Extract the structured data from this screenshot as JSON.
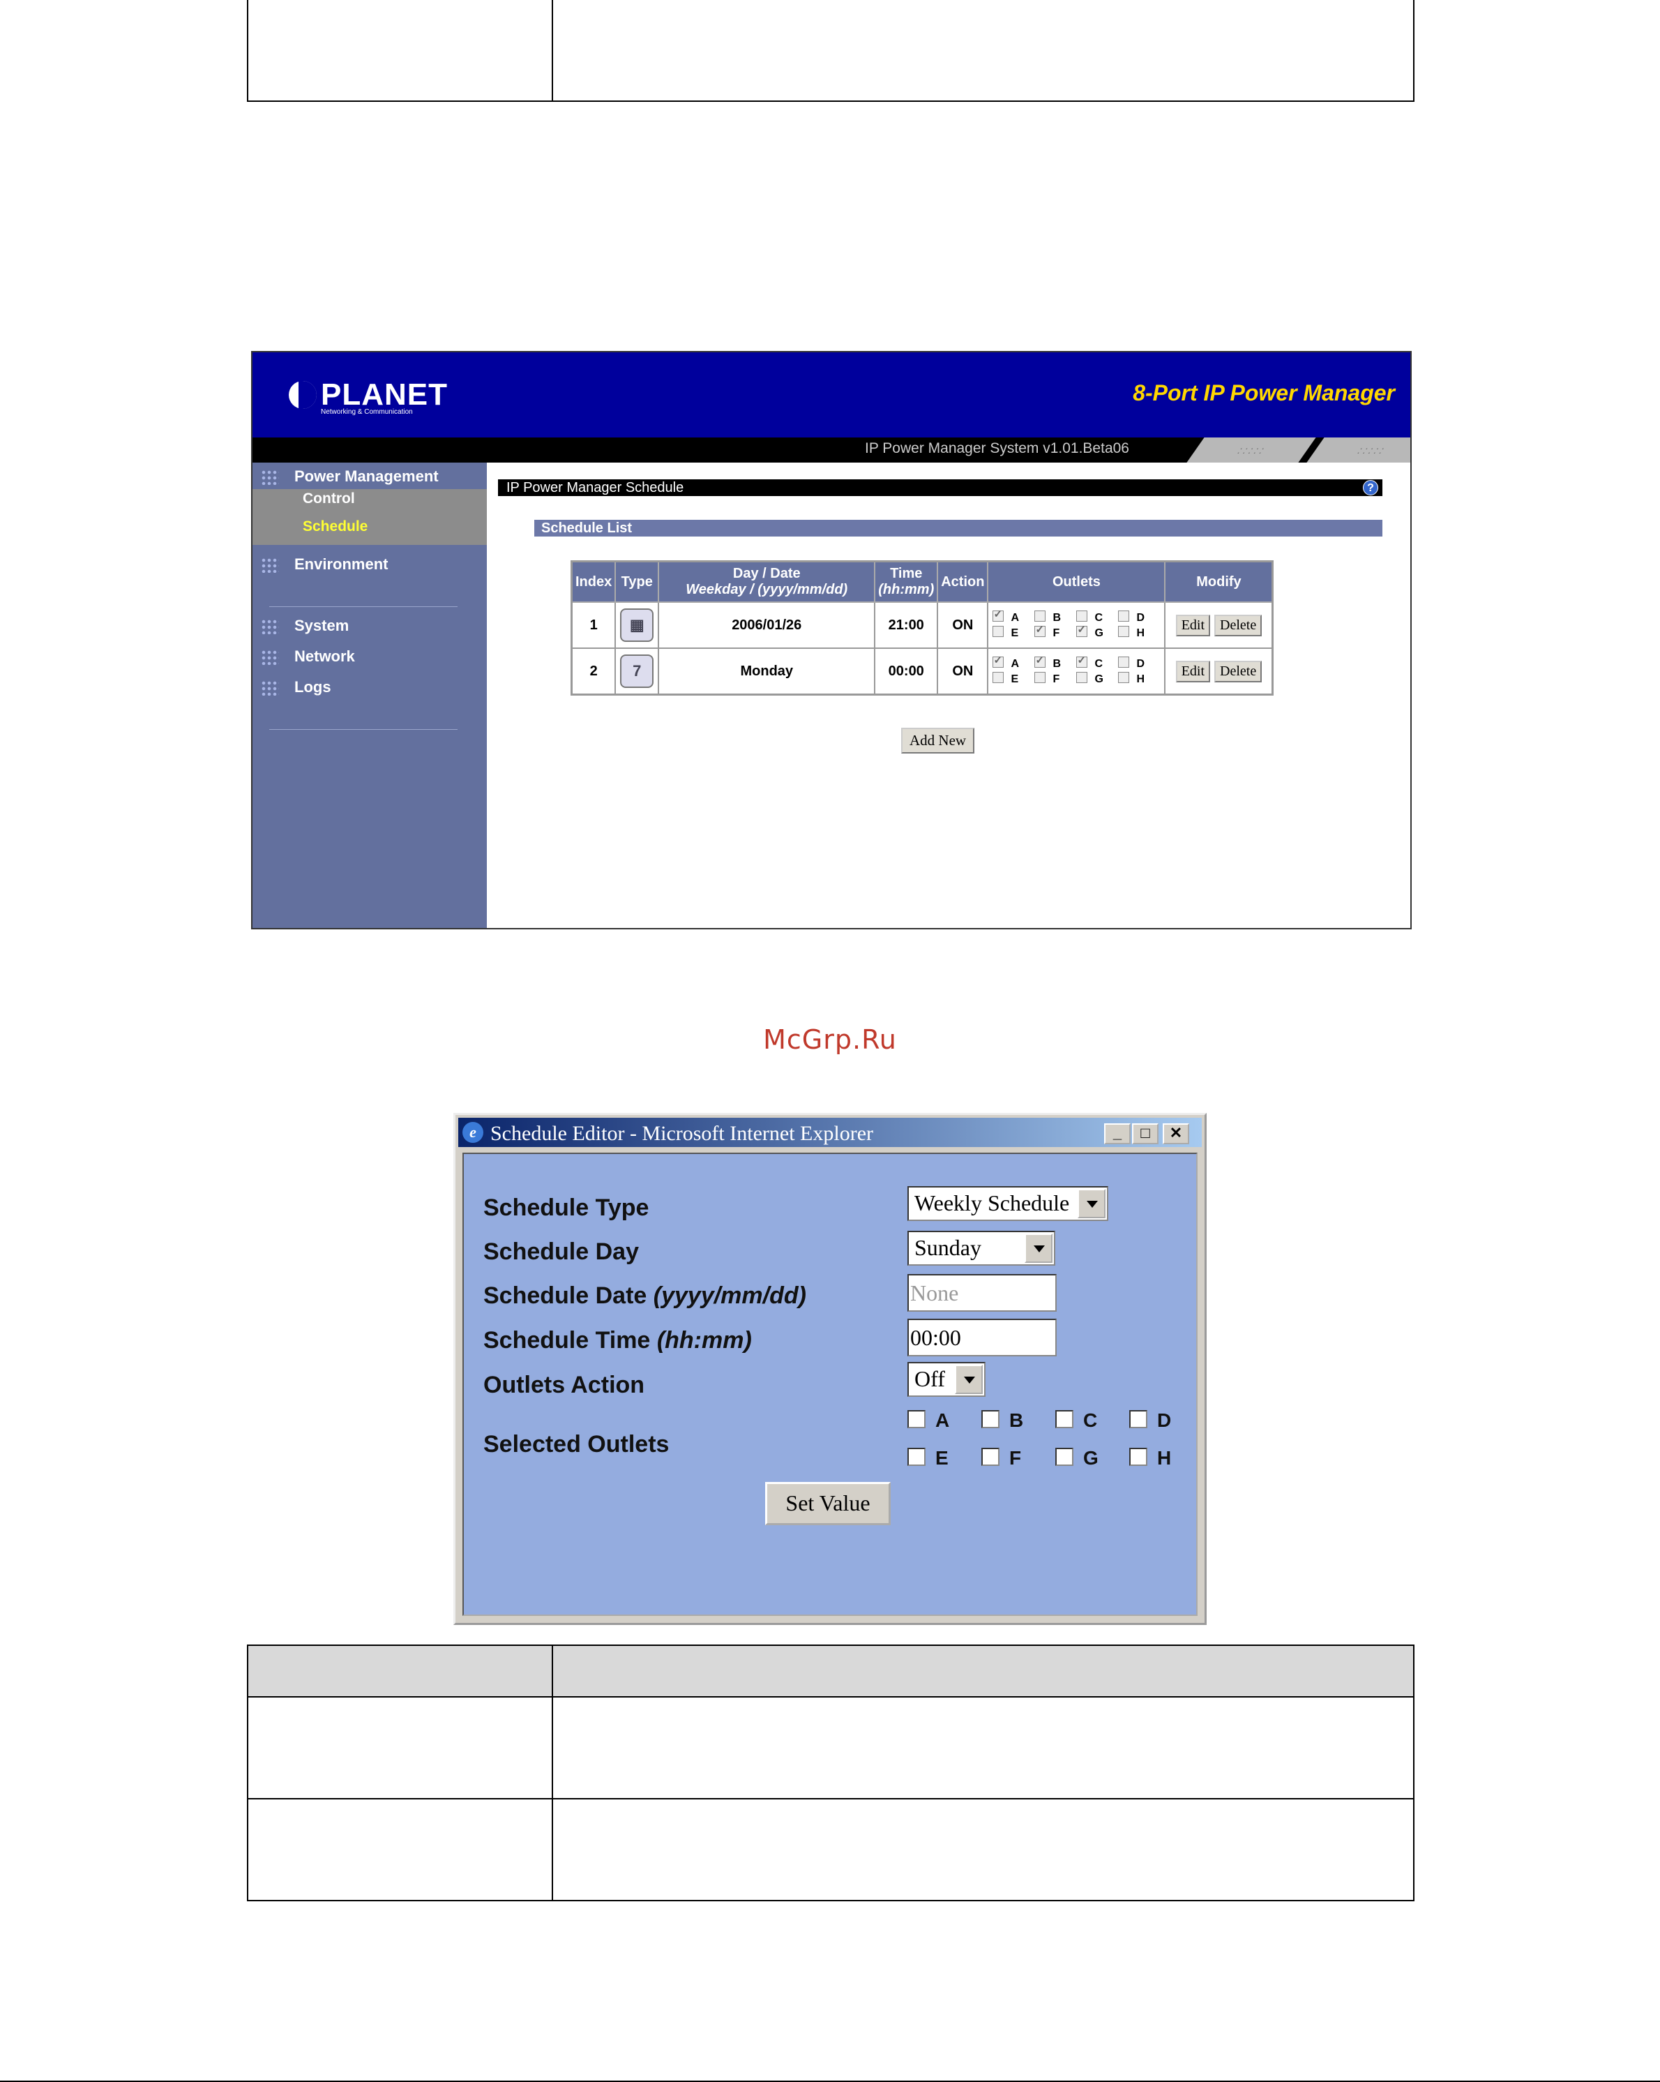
{
  "screenshot1": {
    "logo": {
      "name": "PLANET",
      "sub": "Networking & Communication"
    },
    "product_title": "8-Port IP Power Manager",
    "version": "IP Power Manager System v1.01.Beta06",
    "sidebar": {
      "items": [
        {
          "label": "Power Management"
        },
        {
          "label": "Environment"
        },
        {
          "label": "System"
        },
        {
          "label": "Network"
        },
        {
          "label": "Logs"
        }
      ],
      "subitems": [
        {
          "label": "Control"
        },
        {
          "label": "Schedule"
        }
      ]
    },
    "page_title": "IP Power Manager Schedule",
    "help_icon": "?",
    "section_title": "Schedule List",
    "table": {
      "headers": {
        "index": "Index",
        "type": "Type",
        "daydate": "Day / Date",
        "daydate_sub": "Weekday / (yyyy/mm/dd)",
        "time": "Time",
        "time_sub": "(hh:mm)",
        "action": "Action",
        "outlets": "Outlets",
        "modify": "Modify"
      },
      "rows": [
        {
          "index": "1",
          "type_icon": "calendar-icon",
          "daydate": "2006/01/26",
          "time": "21:00",
          "action": "ON",
          "outlets": [
            "A",
            "B",
            "C",
            "D",
            "E",
            "F",
            "G",
            "H"
          ],
          "checked": [
            true,
            false,
            false,
            false,
            false,
            true,
            true,
            false
          ]
        },
        {
          "index": "2",
          "type_icon": "weekly-icon",
          "daydate": "Monday",
          "time": "00:00",
          "action": "ON",
          "outlets": [
            "A",
            "B",
            "C",
            "D",
            "E",
            "F",
            "G",
            "H"
          ],
          "checked": [
            true,
            true,
            true,
            false,
            false,
            false,
            false,
            false
          ]
        }
      ],
      "edit_label": "Edit",
      "delete_label": "Delete"
    },
    "add_new_label": "Add New"
  },
  "watermark": "McGrp.Ru",
  "screenshot2": {
    "window_title": "Schedule Editor - Microsoft Internet Explorer",
    "fields": {
      "type_label": "Schedule Type",
      "type_value": "Weekly Schedule",
      "day_label": "Schedule Day",
      "day_value": "Sunday",
      "date_label": "Schedule Date",
      "date_format": "(yyyy/mm/dd)",
      "date_value": "None",
      "time_label": "Schedule Time",
      "time_format": "(hh:mm)",
      "time_value": "00:00",
      "action_label": "Outlets Action",
      "action_value": "Off",
      "outlets_label": "Selected Outlets"
    },
    "outlets": [
      "A",
      "B",
      "C",
      "D",
      "E",
      "F",
      "G",
      "H"
    ],
    "set_value_label": "Set Value"
  }
}
